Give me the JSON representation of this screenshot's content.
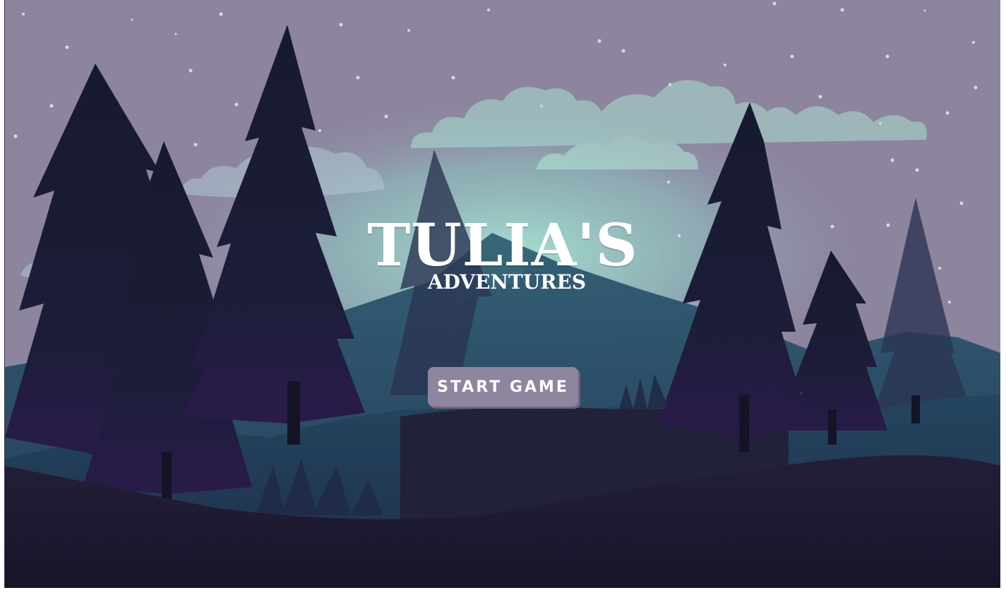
{
  "title": {
    "main": "TULIA'S",
    "sub": "ADVENTURES"
  },
  "start_button": {
    "label": "START GAME"
  },
  "colors": {
    "sky": "#8d849e",
    "glow": "#9fd8cc",
    "tree_dark": "#181a2e",
    "ground": "#1c1930",
    "button": "#8f859f",
    "title_text": "#ffffff"
  }
}
